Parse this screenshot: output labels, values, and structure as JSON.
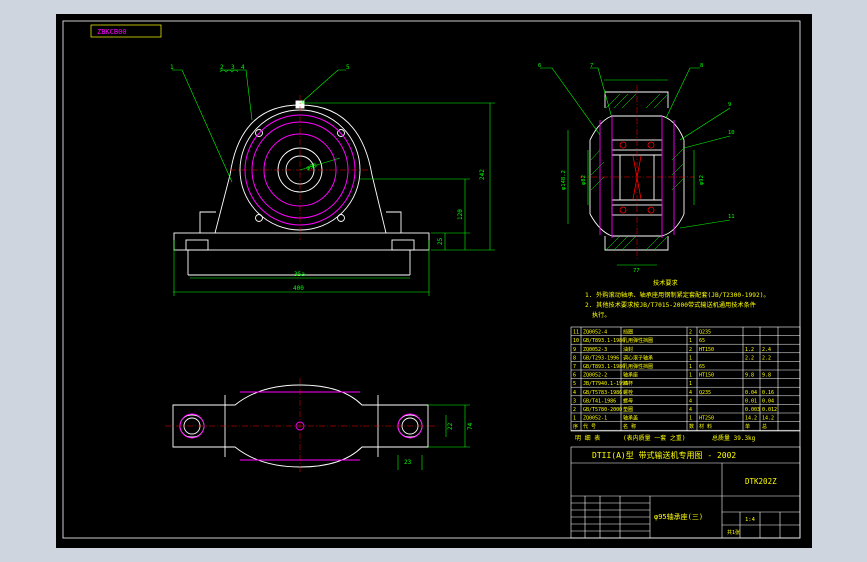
{
  "title_block_stamp": "ZBKCB00",
  "dimensions_front": {
    "bore": "φ95",
    "total_width": "400",
    "bolt_span": "35a",
    "total_height": "242",
    "center_height": "120",
    "base_thickness": "25"
  },
  "dimensions_section": {
    "outer_dia": "φ148.2",
    "seal_dia": "φ82",
    "inner_dia": "φ92",
    "width": "77"
  },
  "dimensions_top": {
    "slot_width": "22",
    "depth": "74",
    "slot_len": "23"
  },
  "leader_numbers_front": [
    "1",
    "2",
    "3",
    "4",
    "5"
  ],
  "leader_numbers_section": [
    "6",
    "7",
    "8",
    "9",
    "10",
    "11"
  ],
  "notes": {
    "heading": "技术要求",
    "lines": [
      "1. 外购滚动轴承、轴承座用钢制紧定套配套(JB/T2300-1992)。",
      "2. 其他技术要求按JB/T7015-2000带式输送机通用技术条件",
      "执行。"
    ]
  },
  "parts_table": {
    "rows": [
      [
        "11",
        "ZQ0052-4",
        "挡圈",
        "2",
        "Q235",
        "",
        ""
      ],
      [
        "10",
        "GB/T893.1-1986",
        "孔用弹性挡圈",
        "1",
        "65",
        "",
        ""
      ],
      [
        "9",
        "ZQ0052-3",
        "油封",
        "2",
        "HT150",
        "1.2",
        "2.4"
      ],
      [
        "8",
        "GB/T293-1996",
        "调心滚子轴承",
        "1",
        "",
        "2.2",
        "2.2"
      ],
      [
        "7",
        "GB/T893.1-1986",
        "孔用弹性挡圈",
        "1",
        "65",
        "",
        ""
      ],
      [
        "6",
        "ZQ0052-2",
        "轴承座",
        "1",
        "HT150",
        "9.8",
        "9.8"
      ],
      [
        "5",
        "JB/T7940.1-1995",
        "油杯",
        "1",
        "",
        "",
        ""
      ],
      [
        "4",
        "GB/T5783-1986",
        "螺栓",
        "4",
        "Q235",
        "0.04",
        "0.16"
      ],
      [
        "3",
        "GB/T41-1986",
        "螺母",
        "4",
        "",
        "0.01",
        "0.04"
      ],
      [
        "2",
        "GB/T5780-2000",
        "垫圈",
        "4",
        "",
        "0.003",
        "0.012"
      ],
      [
        "1",
        "ZQ0052-1",
        "轴承盖",
        "1",
        "HT250",
        "14.2",
        "14.2"
      ]
    ],
    "header": [
      "序",
      "代  号",
      "名  称",
      "数",
      "材  料",
      "单",
      "总"
    ],
    "summary_left": "明  细  表",
    "summary_mid": "(表内质量  一套  之重)",
    "summary_right": "总质量  39.3kg"
  },
  "title_block": {
    "product": "DTII(A)型  带式输送机专用图 - 2002",
    "drawing_no": "DTK202Z",
    "part_name": "φ95轴承座(三)",
    "scale": "1:4",
    "sheets": "共1张"
  },
  "colors": {
    "bg": "#000000",
    "frame": "#ffffff",
    "part": "#ffffff",
    "dim": "#00ff00",
    "circle": "#ff00ff",
    "note": "#ffff00",
    "table_text": "#ffff00",
    "leader": "#00ff00",
    "outer_bg": "#cfd5df"
  }
}
